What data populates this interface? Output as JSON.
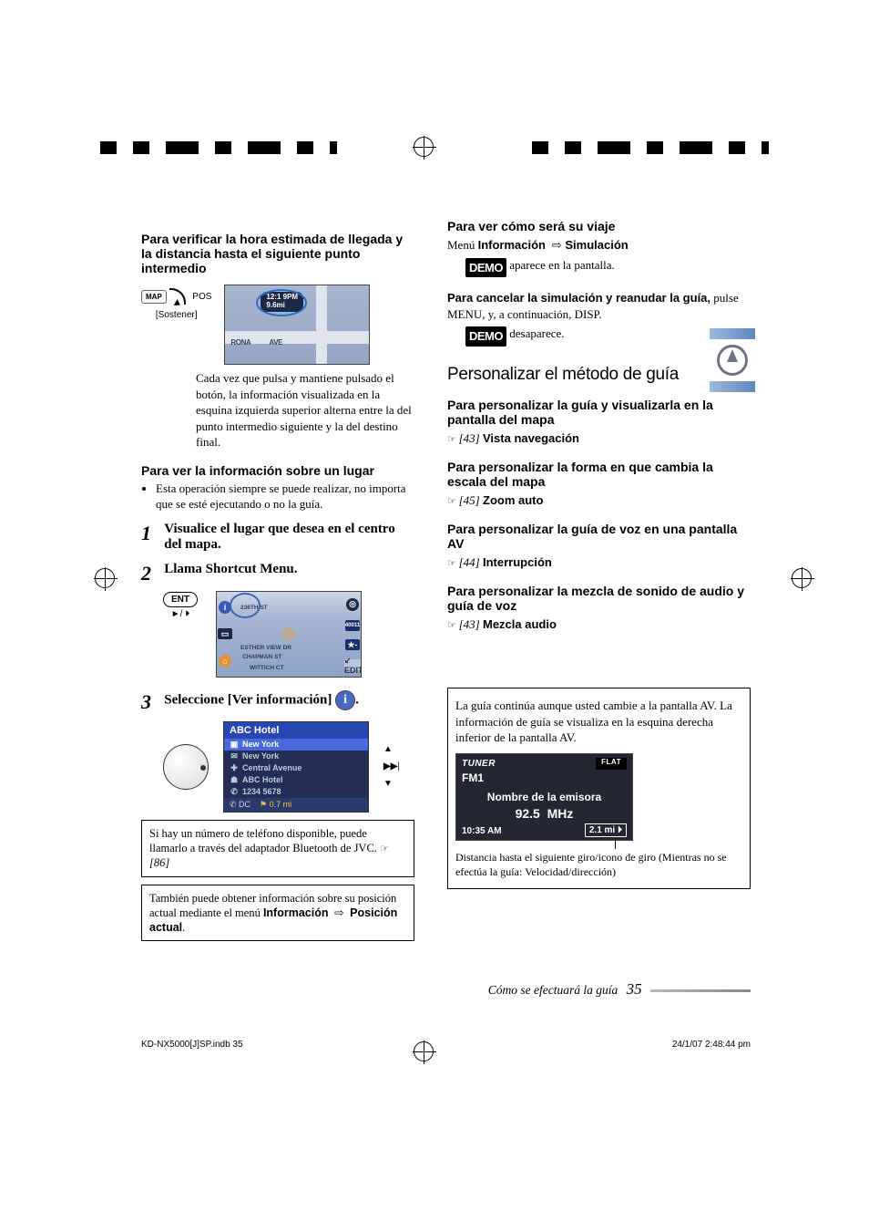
{
  "left": {
    "h1": "Para verificar la hora estimada de llegada y la distancia hasta el siguiente punto intermedio",
    "mapBtn": "MAP",
    "posBtn": "POS",
    "sostener": "[Sostener]",
    "bubble_line1": "12:1 9PM",
    "bubble_line2": "9.6mi",
    "map_label1": "RONA",
    "map_label2": "AVE",
    "p1": "Cada vez que pulsa y mantiene pulsado el botón, la información visualizada en la esquina izquierda superior alterna entre la del punto intermedio siguiente y la del destino final.",
    "h2": "Para ver la información sobre un lugar",
    "bullet1": "Esta operación siempre se puede realizar, no importa que se esté ejecutando o no la guía.",
    "step1_text": "Visualice el lugar que desea en el centro del mapa.",
    "step2_text": "Llama Shortcut Menu.",
    "ent": "ENT",
    "play_mark": "►/ ⏵",
    "shot2": {
      "street1": "236TH ST",
      "street2": "ESTHER VIEW DR",
      "street3": "CHAPMAN ST",
      "street4": "WITTICH CT",
      "badge": "40011",
      "star": "★-",
      "edit": "↙ EDIT"
    },
    "step3_text": "Seleccione [Ver información]",
    "list": {
      "title": "ABC Hotel",
      "r1": "New York",
      "r2": "New York",
      "r3": "Central Avenue",
      "r4": "ABC Hotel",
      "r5": "1234 5678",
      "foot_dc": "DC",
      "foot_dist": "0.7 mi"
    },
    "callout1a": "Si hay un número de teléfono disponible, puede llamarlo a través del adaptador Bluetooth de JVC. ",
    "callout1b": "[86]",
    "callout2a": "También puede obtener información sobre su posición actual mediante el menú",
    "callout2b_l": "Información",
    "callout2b_r": "Posición actual"
  },
  "right": {
    "h1": "Para ver cómo será su viaje",
    "menu_prefix": "Menú ",
    "menu_l": "Información",
    "menu_r": "Simulación",
    "demo": "DEMO",
    "demo_appears": " aparece en la pantalla.",
    "cancel_lead": "Para cancelar la simulación y reanudar la guía,",
    "cancel_rest": " pulse MENU, y, a continuación, DISP.",
    "demo_gone": " desaparece.",
    "section": "Personalizar el método de guía",
    "h2a": "Para personalizar la guía y visualizarla en la pantalla del mapa",
    "ref43": "[43]",
    "opt1": "Vista navegación",
    "h2b": "Para personalizar la forma en que cambia la escala del mapa",
    "ref45": "[45]",
    "opt2": "Zoom auto",
    "h2c": "Para personalizar la guía de voz en una pantalla AV",
    "ref44": "[44]",
    "opt3": "Interrupción",
    "h2d": "Para personalizar la mezcla de sonido de audio y guía de voz",
    "ref43b": "[43]",
    "opt4": "Mezcla audio",
    "avnote": "La guía continúa aunque usted cambie a la pantalla AV. La información de guía se visualiza en la esquina derecha inferior de la pantalla AV.",
    "tuner": {
      "label": "TUNER",
      "flat": "FLAT",
      "band": "FM1",
      "station": "Nombre de la emisora",
      "freq_num": "92.5",
      "freq_unit": "MHz",
      "time": "10:35 AM",
      "dist": "2.1 mi ⏵"
    },
    "dist_caption": "Distancia hasta el siguiente giro/icono de giro (Mientras no se efectúa la guía: Velocidad/dirección)"
  },
  "footer": {
    "section": "Cómo se efectuará la guía",
    "page": "35",
    "file": "KD-NX5000[J]SP.indb   35",
    "timestamp": "24/1/07   2:48:44 pm"
  }
}
